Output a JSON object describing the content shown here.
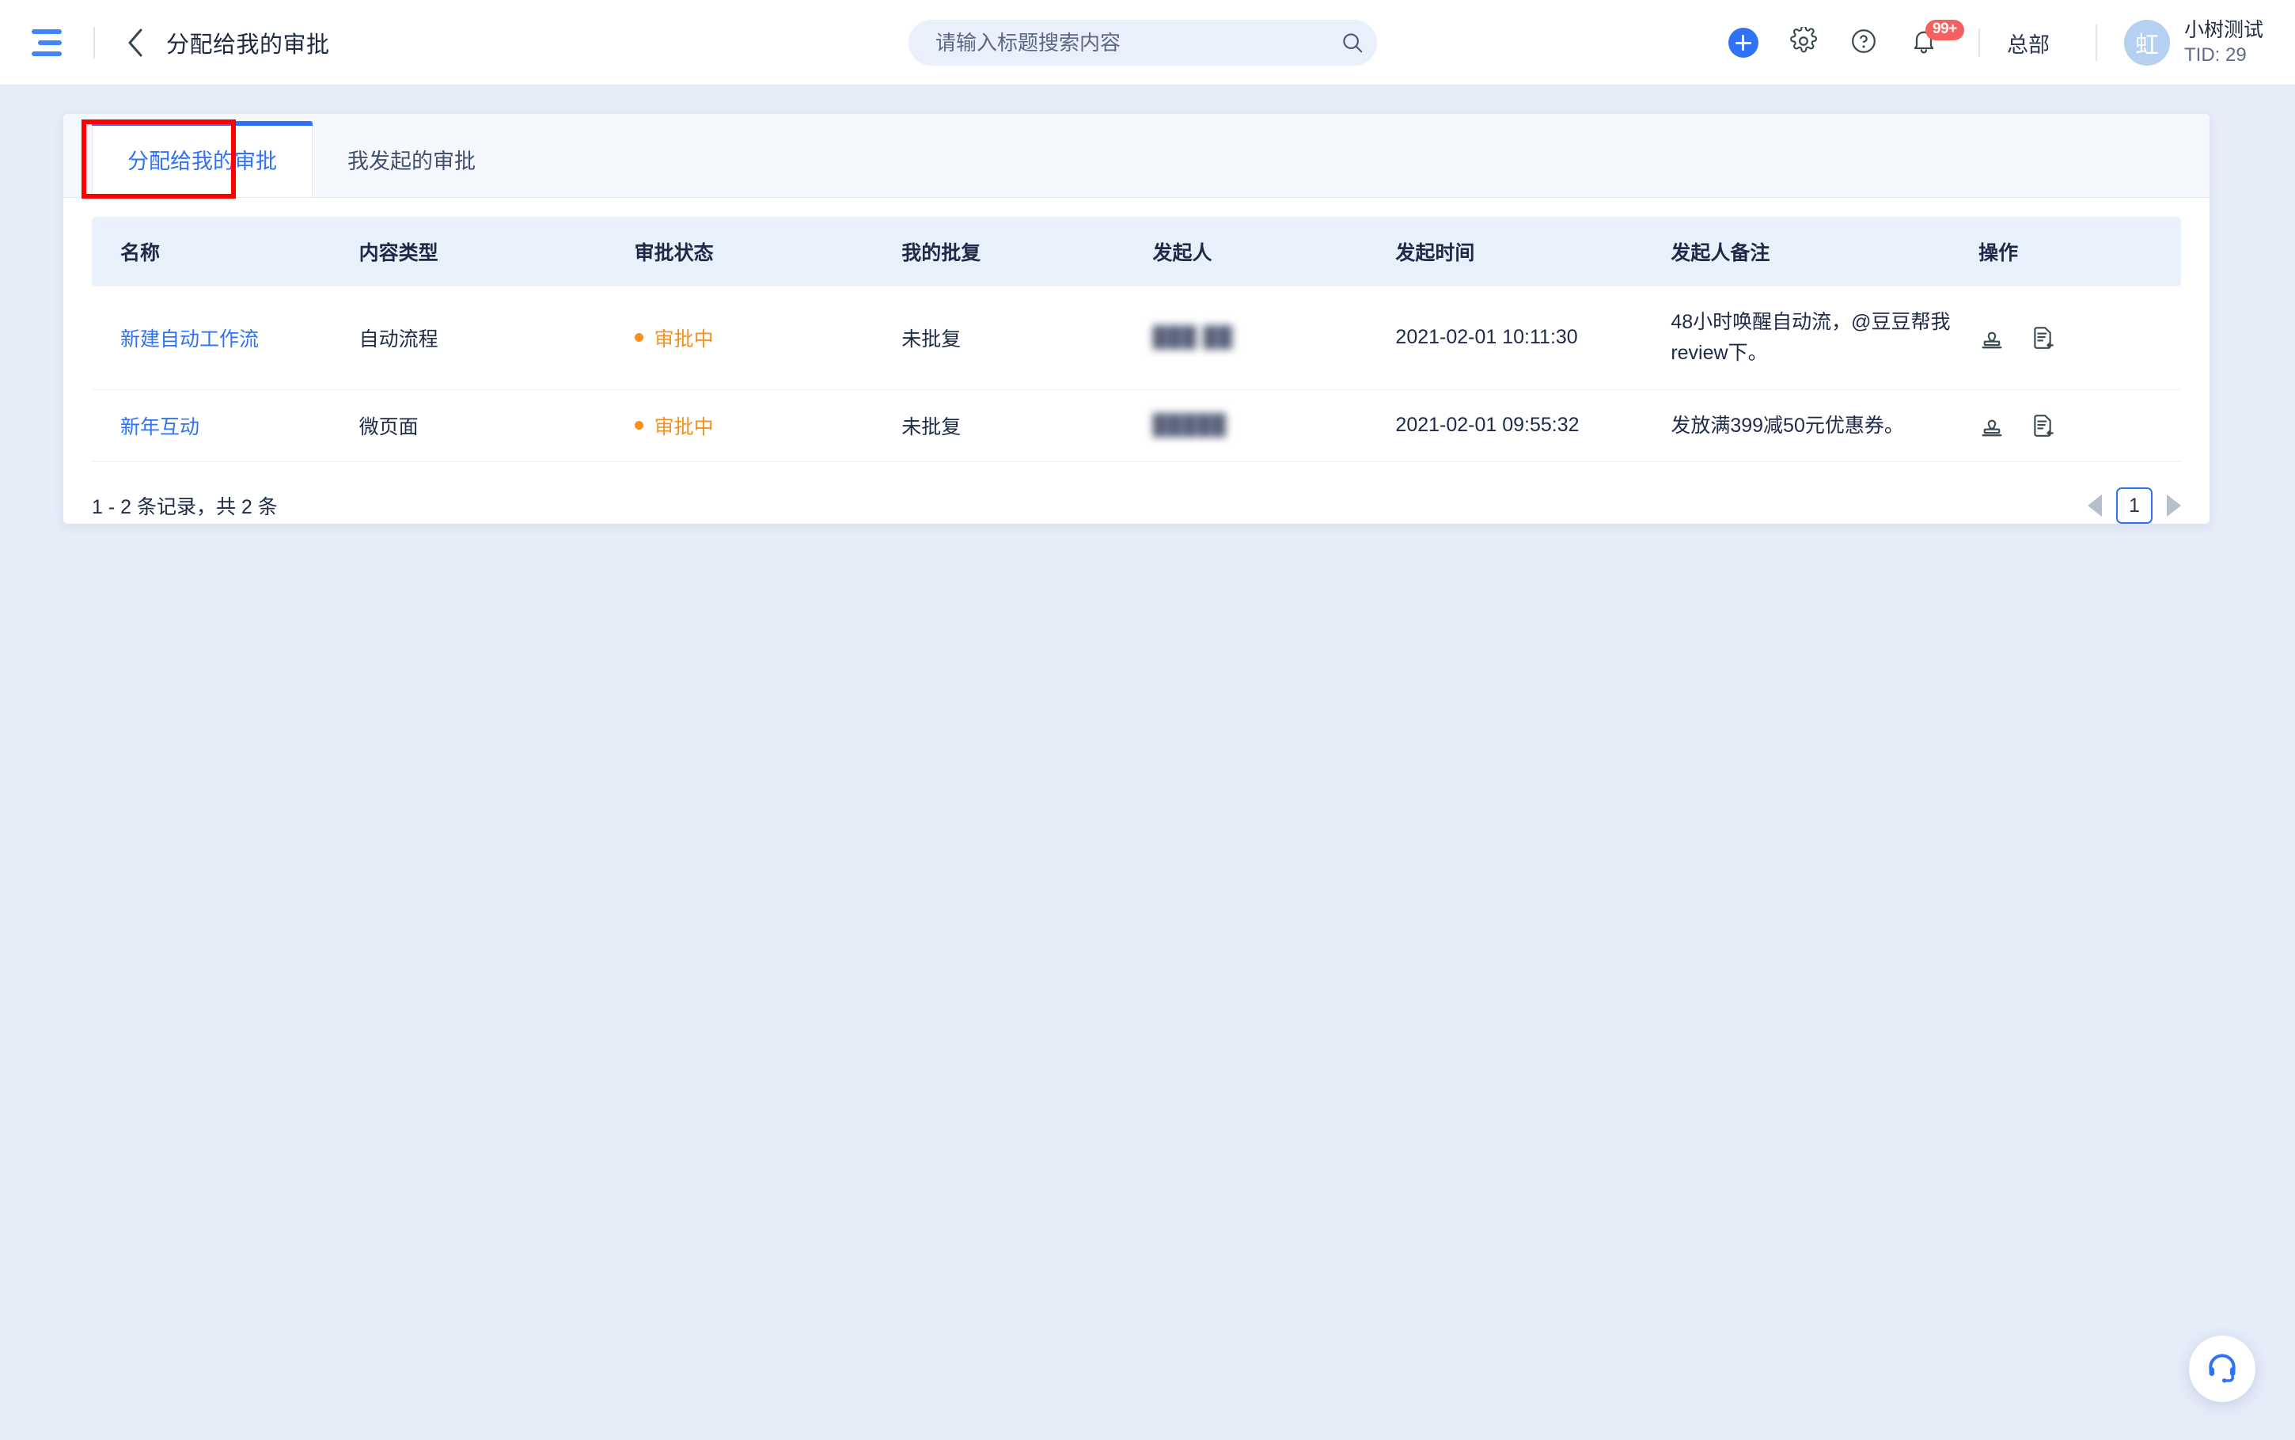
{
  "header": {
    "menu_icon": "hamburger-icon",
    "back_icon": "chevron-left-icon",
    "title": "分配给我的审批",
    "search": {
      "placeholder": "请输入标题搜索内容",
      "value": "",
      "icon": "search-icon"
    },
    "actions": [
      {
        "name": "add-button",
        "icon": "plus-circle-icon"
      },
      {
        "name": "settings-button",
        "icon": "gear-icon"
      },
      {
        "name": "help-button",
        "icon": "question-circle-icon"
      },
      {
        "name": "notifications-button",
        "icon": "bell-icon",
        "badge": "99+"
      }
    ],
    "org_name": "总部",
    "user": {
      "avatar_text": "虹",
      "name": "小树测试",
      "tid": "TID: 29"
    }
  },
  "tabs": [
    {
      "label": "分配给我的审批",
      "active": true
    },
    {
      "label": "我发起的审批",
      "active": false
    }
  ],
  "table": {
    "columns": [
      "名称",
      "内容类型",
      "审批状态",
      "我的批复",
      "发起人",
      "发起时间",
      "发起人备注",
      "操作"
    ],
    "rows": [
      {
        "name": "新建自动工作流",
        "content_type": "自动流程",
        "status": "审批中",
        "my_reply": "未批复",
        "initiator": "███ ██",
        "initiator_blurred": true,
        "time": "2021-02-01 10:11:30",
        "remark": "48小时唤醒自动流，@豆豆帮我review下。",
        "ops": [
          "approve-stamp-icon",
          "reply-document-icon"
        ]
      },
      {
        "name": "新年互动",
        "content_type": "微页面",
        "status": "审批中",
        "my_reply": "未批复",
        "initiator": "█████",
        "initiator_blurred": true,
        "time": "2021-02-01 09:55:32",
        "remark": "发放满399减50元优惠券。",
        "ops": [
          "approve-stamp-icon",
          "reply-document-icon"
        ]
      }
    ]
  },
  "footer": {
    "record_count_text": "1 - 2 条记录，共 2 条",
    "prev_icon": "triangle-left-icon",
    "page_number": "1",
    "next_icon": "triangle-right-icon"
  },
  "support_fab": {
    "icon": "headset-icon"
  },
  "colors": {
    "accent": "#2f72f5",
    "status_pending": "#f5911e",
    "badge_red": "#f4615f",
    "page_bg": "#e6ecf8",
    "table_header_bg": "#e8f1fb",
    "annotation_red": "#ff0000"
  }
}
